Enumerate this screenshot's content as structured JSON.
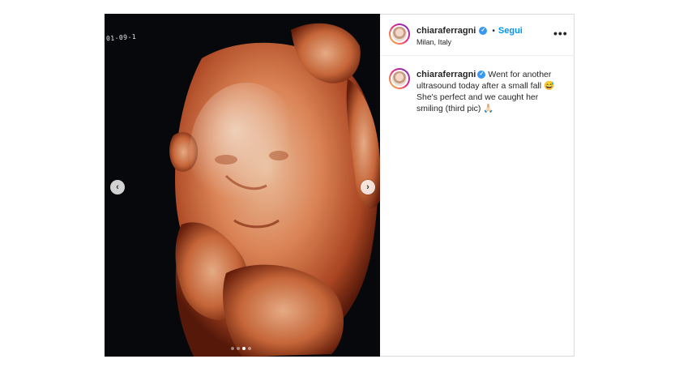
{
  "post": {
    "media": {
      "stamp_text": "01-09-1",
      "carousel": {
        "total": 4,
        "active": 3
      },
      "prev_icon": "chevron-left-icon",
      "next_icon": "chevron-right-icon"
    },
    "header": {
      "username": "chiaraferragni",
      "separator": "•",
      "follow_label": "Segui",
      "location": "Milan, Italy",
      "more_icon": "ellipsis-icon",
      "more_label": "•••"
    },
    "caption": {
      "username": "chiaraferragni",
      "text": "Went for another ultrasound today after a small fall 😅 She's perfect and we caught her smiling (third pic) 🙏🏻"
    },
    "colors": {
      "accent": "#0095f6",
      "verified": "#3897f0",
      "border": "#dbdbdb"
    }
  }
}
